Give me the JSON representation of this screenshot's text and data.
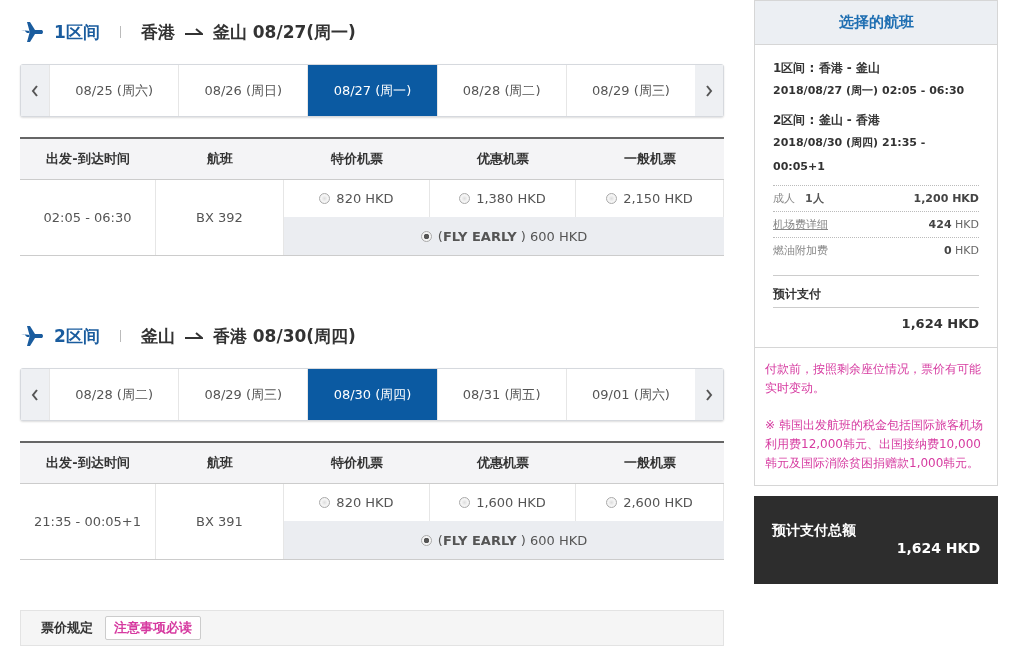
{
  "segments": [
    {
      "label": "1区间",
      "from": "香港",
      "to": "釜山",
      "date": "08/27(周一)",
      "dates": [
        {
          "label": "08/25 (周六)",
          "selected": false
        },
        {
          "label": "08/26 (周日)",
          "selected": false
        },
        {
          "label": "08/27 (周一)",
          "selected": true
        },
        {
          "label": "08/28 (周二)",
          "selected": false
        },
        {
          "label": "08/29 (周三)",
          "selected": false
        }
      ],
      "columns": [
        "出发-到达时间",
        "航班",
        "特价机票",
        "优惠机票",
        "一般机票"
      ],
      "flight": {
        "time": "02:05 - 06:30",
        "number": "BX 392",
        "fares": [
          {
            "price": "820 HKD",
            "selected": false
          },
          {
            "price": "1,380 HKD",
            "selected": false
          },
          {
            "price": "2,150 HKD",
            "selected": false
          }
        ],
        "special": {
          "label": "(**FLY EARLY** ) 600 HKD",
          "selected": true
        }
      }
    },
    {
      "label": "2区间",
      "from": "釜山",
      "to": "香港",
      "date": "08/30(周四)",
      "dates": [
        {
          "label": "08/28 (周二)",
          "selected": false
        },
        {
          "label": "08/29 (周三)",
          "selected": false
        },
        {
          "label": "08/30 (周四)",
          "selected": true
        },
        {
          "label": "08/31 (周五)",
          "selected": false
        },
        {
          "label": "09/01 (周六)",
          "selected": false
        }
      ],
      "columns": [
        "出发-到达时间",
        "航班",
        "特价机票",
        "优惠机票",
        "一般机票"
      ],
      "flight": {
        "time": "21:35 - 00:05+1",
        "number": "BX 391",
        "fares": [
          {
            "price": "820 HKD",
            "selected": false
          },
          {
            "price": "1,600 HKD",
            "selected": false
          },
          {
            "price": "2,600 HKD",
            "selected": false
          }
        ],
        "special": {
          "label": "(**FLY EARLY** ) 600 HKD",
          "selected": true
        }
      }
    }
  ],
  "fare_rules": {
    "label": "票价规定",
    "button": "注意事项必读"
  },
  "summary": {
    "title": "选择的航班",
    "legs": [
      {
        "title": "1区间 : 香港 - 釜山",
        "detail": "2018/08/27 (周一) 02:05 - 06:30"
      },
      {
        "title": "2区间 : 釜山 - 香港",
        "detail": "2018/08/30 (周四) 21:35 - 00:05+1"
      }
    ],
    "costs": [
      {
        "kind": "passenger",
        "label": "成人",
        "qty": "1人",
        "amount": "**1,200 HKD**"
      },
      {
        "kind": "link",
        "label": "机场费详细",
        "amount": "**424** HKD"
      },
      {
        "kind": "plain",
        "label": "燃油附加费",
        "amount": "**0** HKD"
      }
    ],
    "total_label": "预计支付",
    "total": "1,624 HKD",
    "notices": [
      "付款前，按照剩余座位情况，票价有可能实时变动。",
      "※ 韩国出发航班的税金包括国际旅客机场利用费12,000韩元、出国接纳费10,000韩元及国际消除贫困捐赠款1,000韩元。"
    ],
    "grand_total": {
      "label": "预计支付总额",
      "amount": "1,624 HKD"
    }
  }
}
